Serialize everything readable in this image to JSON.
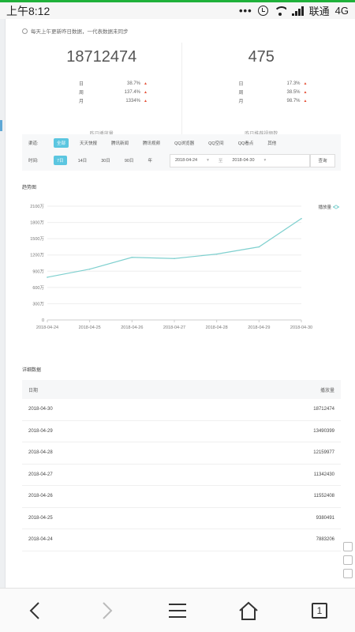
{
  "statusbar": {
    "time": "上午8:12",
    "carrier": "联通",
    "network": "4G"
  },
  "notice": "每天上午更新昨日数据，一代表数据未同步",
  "kpis": [
    {
      "value": "18712474",
      "rows": [
        {
          "k": "日",
          "v": "38.7%"
        },
        {
          "k": "周",
          "v": "137.4%"
        },
        {
          "k": "月",
          "v": "1334%"
        }
      ],
      "label": "昨日播放量"
    },
    {
      "value": "475",
      "rows": [
        {
          "k": "日",
          "v": "17.3%"
        },
        {
          "k": "周",
          "v": "38.5%"
        },
        {
          "k": "月",
          "v": "98.7%"
        }
      ],
      "label": "昨日推荐视频数"
    }
  ],
  "filter": {
    "channel_label": "渠道:",
    "channels": [
      "全部",
      "天天快报",
      "腾讯新闻",
      "腾讯视频",
      "QQ浏览器",
      "QQ空间",
      "QQ看点",
      "其他"
    ],
    "time_label": "时间:",
    "periods": [
      "7日",
      "14日",
      "30日",
      "90日",
      "年"
    ],
    "date_from": "2018-04-24",
    "date_sep": "至",
    "date_to": "2018-04-30",
    "query_label": "查询"
  },
  "chart_title": "趋势图",
  "chart_data": {
    "type": "line",
    "x": [
      "2018-04-24",
      "2018-04-25",
      "2018-04-26",
      "2018-04-27",
      "2018-04-28",
      "2018-04-29",
      "2018-04-30"
    ],
    "series": [
      {
        "name": "播放量",
        "values": [
          7883206,
          9380491,
          11552408,
          11342430,
          12159977,
          13490399,
          18712474
        ]
      }
    ],
    "yticks": [
      "0",
      "300万",
      "600万",
      "900万",
      "1200万",
      "1500万",
      "1800万",
      "2100万"
    ],
    "ylim": [
      0,
      21000000
    ],
    "grid": true,
    "legend": "top-right",
    "color": "#7fd0cf"
  },
  "detail_title": "详细数据",
  "table": {
    "headers": [
      "日期",
      "播放量"
    ],
    "rows": [
      [
        "2018-04-30",
        "18712474"
      ],
      [
        "2018-04-29",
        "13490399"
      ],
      [
        "2018-04-28",
        "12159977"
      ],
      [
        "2018-04-27",
        "11342430"
      ],
      [
        "2018-04-26",
        "11552408"
      ],
      [
        "2018-04-25",
        "9380491"
      ],
      [
        "2018-04-24",
        "7883206"
      ]
    ]
  },
  "tab_count": "1"
}
